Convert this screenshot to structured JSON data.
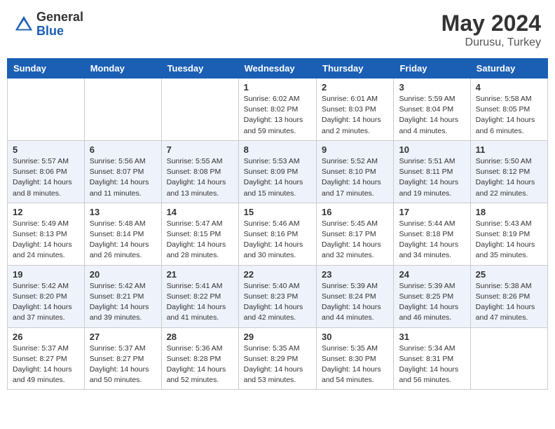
{
  "header": {
    "logo_general": "General",
    "logo_blue": "Blue",
    "month_year": "May 2024",
    "location": "Durusu, Turkey"
  },
  "days_of_week": [
    "Sunday",
    "Monday",
    "Tuesday",
    "Wednesday",
    "Thursday",
    "Friday",
    "Saturday"
  ],
  "weeks": [
    [
      {
        "day": "",
        "info": ""
      },
      {
        "day": "",
        "info": ""
      },
      {
        "day": "",
        "info": ""
      },
      {
        "day": "1",
        "info": "Sunrise: 6:02 AM\nSunset: 8:02 PM\nDaylight: 13 hours\nand 59 minutes."
      },
      {
        "day": "2",
        "info": "Sunrise: 6:01 AM\nSunset: 8:03 PM\nDaylight: 14 hours\nand 2 minutes."
      },
      {
        "day": "3",
        "info": "Sunrise: 5:59 AM\nSunset: 8:04 PM\nDaylight: 14 hours\nand 4 minutes."
      },
      {
        "day": "4",
        "info": "Sunrise: 5:58 AM\nSunset: 8:05 PM\nDaylight: 14 hours\nand 6 minutes."
      }
    ],
    [
      {
        "day": "5",
        "info": "Sunrise: 5:57 AM\nSunset: 8:06 PM\nDaylight: 14 hours\nand 8 minutes."
      },
      {
        "day": "6",
        "info": "Sunrise: 5:56 AM\nSunset: 8:07 PM\nDaylight: 14 hours\nand 11 minutes."
      },
      {
        "day": "7",
        "info": "Sunrise: 5:55 AM\nSunset: 8:08 PM\nDaylight: 14 hours\nand 13 minutes."
      },
      {
        "day": "8",
        "info": "Sunrise: 5:53 AM\nSunset: 8:09 PM\nDaylight: 14 hours\nand 15 minutes."
      },
      {
        "day": "9",
        "info": "Sunrise: 5:52 AM\nSunset: 8:10 PM\nDaylight: 14 hours\nand 17 minutes."
      },
      {
        "day": "10",
        "info": "Sunrise: 5:51 AM\nSunset: 8:11 PM\nDaylight: 14 hours\nand 19 minutes."
      },
      {
        "day": "11",
        "info": "Sunrise: 5:50 AM\nSunset: 8:12 PM\nDaylight: 14 hours\nand 22 minutes."
      }
    ],
    [
      {
        "day": "12",
        "info": "Sunrise: 5:49 AM\nSunset: 8:13 PM\nDaylight: 14 hours\nand 24 minutes."
      },
      {
        "day": "13",
        "info": "Sunrise: 5:48 AM\nSunset: 8:14 PM\nDaylight: 14 hours\nand 26 minutes."
      },
      {
        "day": "14",
        "info": "Sunrise: 5:47 AM\nSunset: 8:15 PM\nDaylight: 14 hours\nand 28 minutes."
      },
      {
        "day": "15",
        "info": "Sunrise: 5:46 AM\nSunset: 8:16 PM\nDaylight: 14 hours\nand 30 minutes."
      },
      {
        "day": "16",
        "info": "Sunrise: 5:45 AM\nSunset: 8:17 PM\nDaylight: 14 hours\nand 32 minutes."
      },
      {
        "day": "17",
        "info": "Sunrise: 5:44 AM\nSunset: 8:18 PM\nDaylight: 14 hours\nand 34 minutes."
      },
      {
        "day": "18",
        "info": "Sunrise: 5:43 AM\nSunset: 8:19 PM\nDaylight: 14 hours\nand 35 minutes."
      }
    ],
    [
      {
        "day": "19",
        "info": "Sunrise: 5:42 AM\nSunset: 8:20 PM\nDaylight: 14 hours\nand 37 minutes."
      },
      {
        "day": "20",
        "info": "Sunrise: 5:42 AM\nSunset: 8:21 PM\nDaylight: 14 hours\nand 39 minutes."
      },
      {
        "day": "21",
        "info": "Sunrise: 5:41 AM\nSunset: 8:22 PM\nDaylight: 14 hours\nand 41 minutes."
      },
      {
        "day": "22",
        "info": "Sunrise: 5:40 AM\nSunset: 8:23 PM\nDaylight: 14 hours\nand 42 minutes."
      },
      {
        "day": "23",
        "info": "Sunrise: 5:39 AM\nSunset: 8:24 PM\nDaylight: 14 hours\nand 44 minutes."
      },
      {
        "day": "24",
        "info": "Sunrise: 5:39 AM\nSunset: 8:25 PM\nDaylight: 14 hours\nand 46 minutes."
      },
      {
        "day": "25",
        "info": "Sunrise: 5:38 AM\nSunset: 8:26 PM\nDaylight: 14 hours\nand 47 minutes."
      }
    ],
    [
      {
        "day": "26",
        "info": "Sunrise: 5:37 AM\nSunset: 8:27 PM\nDaylight: 14 hours\nand 49 minutes."
      },
      {
        "day": "27",
        "info": "Sunrise: 5:37 AM\nSunset: 8:27 PM\nDaylight: 14 hours\nand 50 minutes."
      },
      {
        "day": "28",
        "info": "Sunrise: 5:36 AM\nSunset: 8:28 PM\nDaylight: 14 hours\nand 52 minutes."
      },
      {
        "day": "29",
        "info": "Sunrise: 5:35 AM\nSunset: 8:29 PM\nDaylight: 14 hours\nand 53 minutes."
      },
      {
        "day": "30",
        "info": "Sunrise: 5:35 AM\nSunset: 8:30 PM\nDaylight: 14 hours\nand 54 minutes."
      },
      {
        "day": "31",
        "info": "Sunrise: 5:34 AM\nSunset: 8:31 PM\nDaylight: 14 hours\nand 56 minutes."
      },
      {
        "day": "",
        "info": ""
      }
    ]
  ]
}
